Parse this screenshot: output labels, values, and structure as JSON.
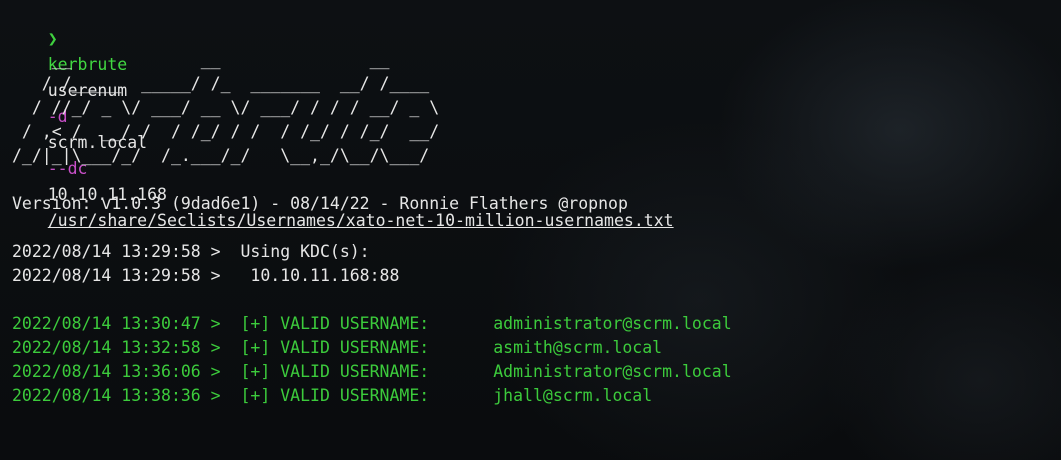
{
  "command": {
    "prompt_symbol": "❯",
    "tool": "kerbrute",
    "subcommand": "userenum",
    "domain_flag": "-d",
    "domain": "scrm.local",
    "dc_flag": "--dc",
    "dc": "10.10.11.168",
    "wordlist": "/usr/share/Seclists/Usernames/xato-net-10-million-usernames.txt"
  },
  "banner": "    __             __               __     \n   / /_____  _____/ /_  _______  __/ /____ \n  / //_/ _ \\/ ___/ __ \\/ ___/ / / / __/ _ \\\n / ,< /  __/ /  / /_/ / /  / /_/ / /_/  __/\n/_/|_|\\___/_/  /_.___/_/   \\__,_/\\__/\\___/ ",
  "version": "Version: v1.0.3 (9dad6e1) - 08/14/22 - Ronnie Flathers @ropnop",
  "kdc_lines": [
    "2022/08/14 13:29:58 >  Using KDC(s):",
    "2022/08/14 13:29:58 >   10.10.11.168:88"
  ],
  "results": [
    {
      "prefix": "2022/08/14 13:30:47 >  [+] VALID USERNAME:",
      "user": "administrator@scrm.local"
    },
    {
      "prefix": "2022/08/14 13:32:58 >  [+] VALID USERNAME:",
      "user": "asmith@scrm.local"
    },
    {
      "prefix": "2022/08/14 13:36:06 >  [+] VALID USERNAME:",
      "user": "Administrator@scrm.local"
    },
    {
      "prefix": "2022/08/14 13:38:36 >  [+] VALID USERNAME:",
      "user": "jhall@scrm.local"
    }
  ],
  "colors": {
    "prompt": "#3fd13f",
    "flag": "#c74fc7",
    "valid": "#3ccb3c",
    "text": "#e6e6e6"
  }
}
